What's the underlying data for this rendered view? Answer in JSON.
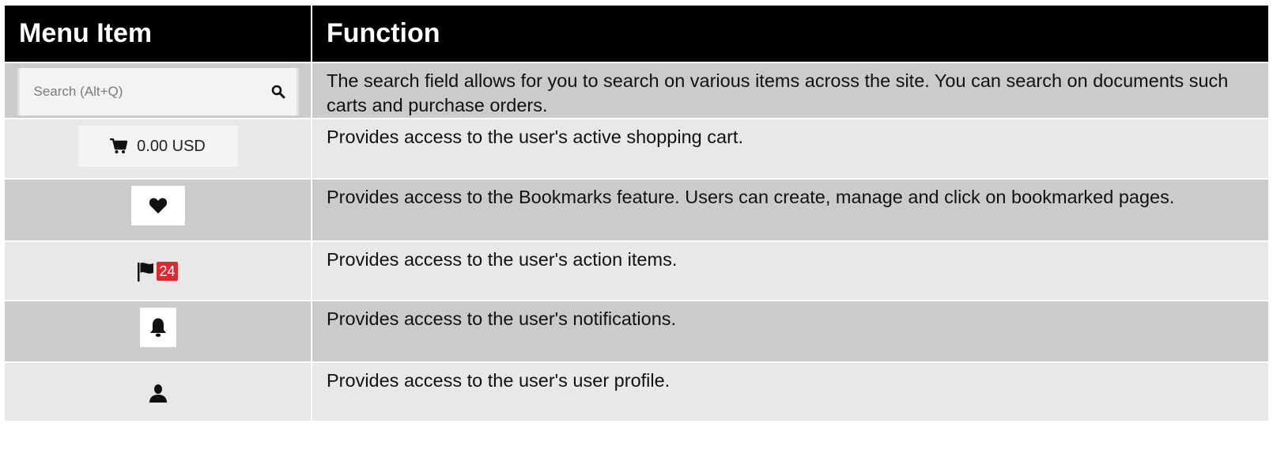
{
  "table": {
    "header": {
      "menu_item": "Menu Item",
      "function": "Function"
    },
    "rows": [
      {
        "item": "search",
        "placeholder": "Search (Alt+Q)",
        "icon": "search-icon",
        "description": "The search field allows for you to search on various items across the site. You can search on documents such carts and purchase orders."
      },
      {
        "item": "cart",
        "amount": "0.00 USD",
        "icon": "cart-icon",
        "description": "Provides access to the user's active shopping cart."
      },
      {
        "item": "bookmarks",
        "icon": "heart-icon",
        "description": "Provides access to the Bookmarks feature. Users can create, manage and click on bookmarked pages."
      },
      {
        "item": "action-items",
        "icon": "flag-icon",
        "badge": "24",
        "description": "Provides access to the user's action items."
      },
      {
        "item": "notifications",
        "icon": "bell-icon",
        "description": "Provides access to the user's notifications."
      },
      {
        "item": "profile",
        "icon": "user-icon",
        "description": "Provides access to the user's user profile."
      }
    ]
  },
  "colors": {
    "header_bg": "#000000",
    "row_dark": "#cbcbcb",
    "row_light": "#e8e8e8",
    "badge": "#e0282e"
  }
}
